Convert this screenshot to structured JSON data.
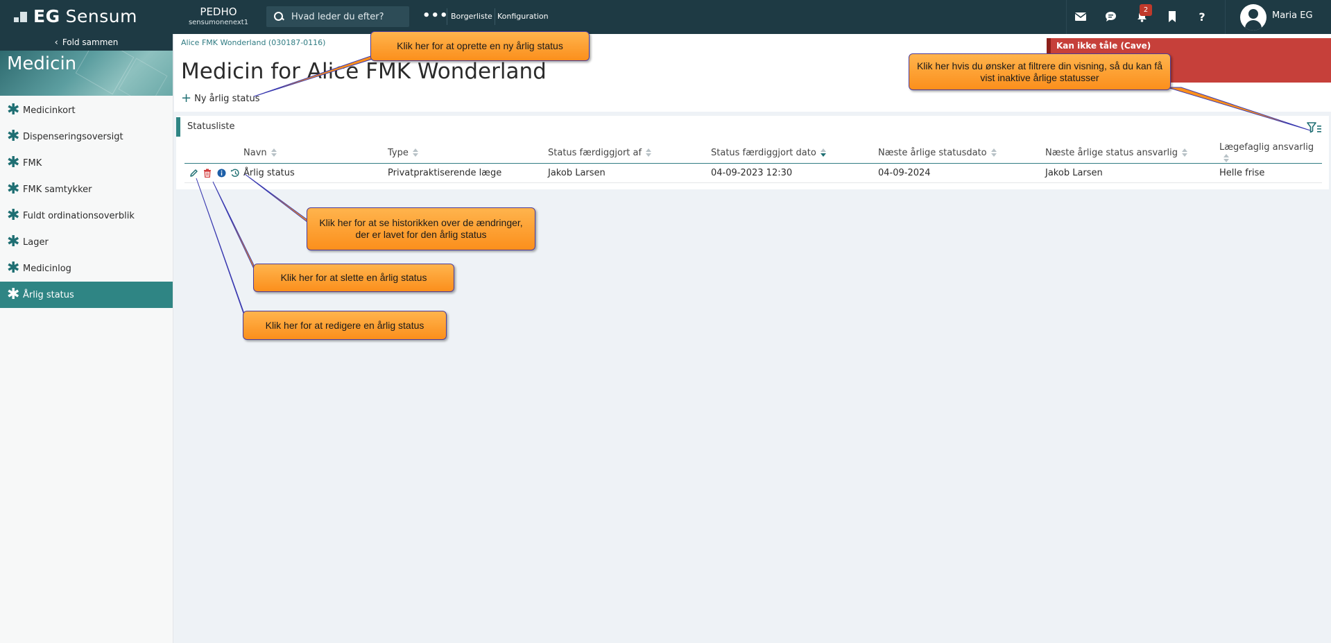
{
  "topbar": {
    "logo_eg": "EG",
    "logo_sensum": "Sensum",
    "org_name": "PEDHO",
    "org_sub": "sensumonenext1",
    "search_placeholder": "Hvad leder du efter?",
    "more": "•••",
    "nav_borgerliste": "Borgerliste",
    "nav_konfiguration": "Konfiguration",
    "notifications_count": "2",
    "user_name": "Maria EG"
  },
  "sidebar": {
    "fold_label": "Fold sammen",
    "section_title": "Medicin",
    "items": [
      {
        "label": "Medicinkort"
      },
      {
        "label": "Dispenseringsoversigt"
      },
      {
        "label": "FMK"
      },
      {
        "label": "FMK samtykker"
      },
      {
        "label": "Fuldt ordinationsoverblik"
      },
      {
        "label": "Lager"
      },
      {
        "label": "Medicinlog"
      },
      {
        "label": "Årlig status"
      }
    ]
  },
  "main": {
    "breadcrumb": "Alice FMK Wonderland (030187-0116)",
    "title": "Medicin for Alice FMK Wonderland",
    "new_button": "Ny årlig status",
    "cave_title": "Kan ikke tåle (Cave)",
    "card_title": "Statusliste",
    "columns": [
      "Navn",
      "Type",
      "Status færdiggjort af",
      "Status færdiggjort dato",
      "Næste årlige statusdato",
      "Næste årlige status ansvarlig",
      "Lægefaglig ansvarlig"
    ],
    "rows": [
      [
        "Årlig status",
        "Privatpraktiserende læge",
        "Jakob Larsen",
        "04-09-2023 12:30",
        "04-09-2024",
        "Jakob Larsen",
        "Helle frise"
      ]
    ]
  },
  "callouts": {
    "new": "Klik her for at oprette en ny årlig status",
    "filter": "Klik her hvis du ønsker at filtrere din visning, så du kan få vist inaktive årlige statusser",
    "history": "Klik her for at se historikken over de ændringer, der er lavet for den årlig status",
    "delete": "Klik her for at slette en årlig status",
    "edit": "Klik her for at redigere en årlig status"
  },
  "colors": {
    "topbar": "#1e3a44",
    "accent": "#2f8584",
    "cave": "#c6403a",
    "callout": "#fb8f1c"
  }
}
